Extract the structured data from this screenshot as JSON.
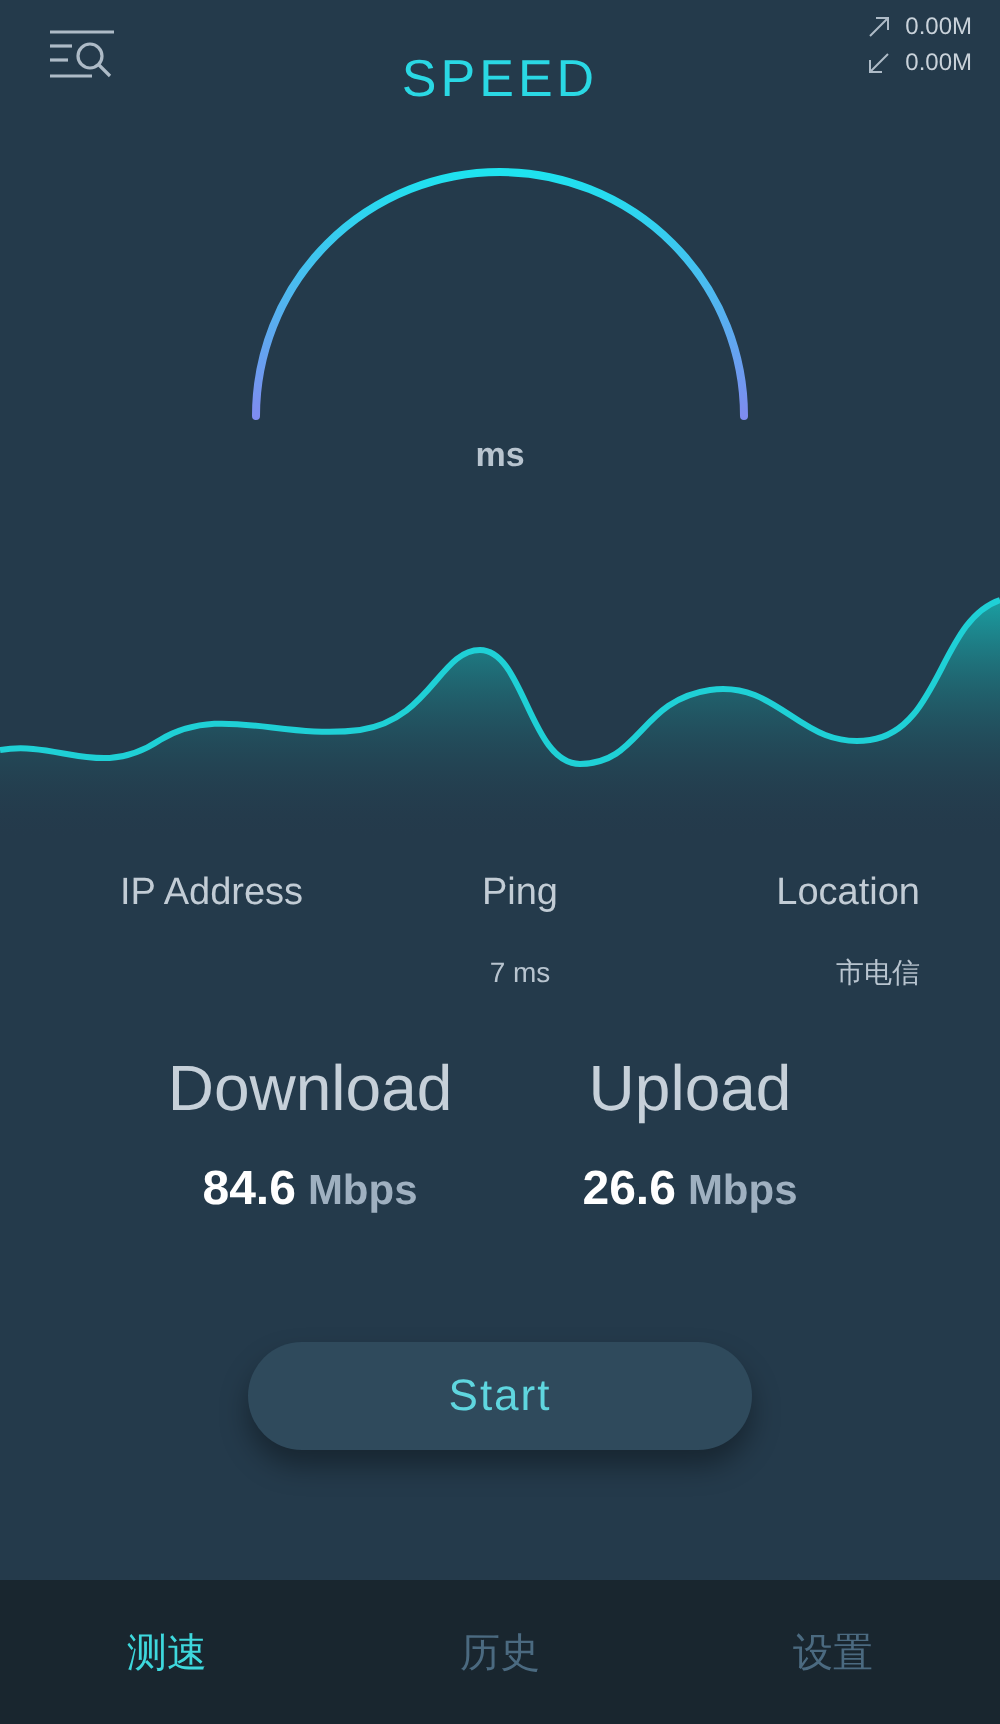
{
  "header": {
    "title": "SPEED",
    "upload_total": "0.00M",
    "download_total": "0.00M"
  },
  "gauge": {
    "unit": "ms"
  },
  "info": [
    {
      "label": "IP Address"
    },
    {
      "label": "Ping",
      "value": "7 ms"
    },
    {
      "label": "Location",
      "value": "市电信"
    }
  ],
  "results": [
    {
      "label": "Download",
      "value": "84.6",
      "unit": "Mbps"
    },
    {
      "label": "Upload",
      "value": "26.6",
      "unit": "Mbps"
    }
  ],
  "start_button": "Start",
  "tabs": [
    {
      "label": "测速",
      "selected": true
    },
    {
      "label": "历史",
      "selected": false
    },
    {
      "label": "设置",
      "selected": false
    }
  ]
}
